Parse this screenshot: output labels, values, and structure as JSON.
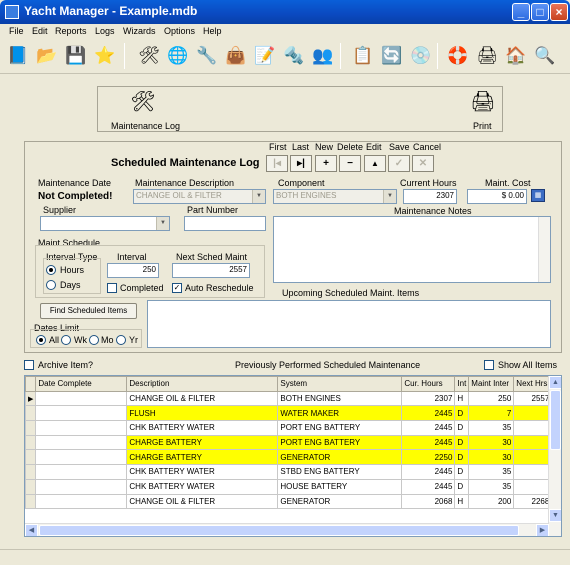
{
  "window": {
    "title": "Yacht Manager - Example.mdb"
  },
  "menu": [
    "File",
    "Edit",
    "Reports",
    "Logs",
    "Wizards",
    "Options",
    "Help"
  ],
  "toolbar": {
    "icons": [
      {
        "name": "book-icon",
        "glyph": "📘"
      },
      {
        "name": "folder-icon",
        "glyph": "📂"
      },
      {
        "name": "save-icon",
        "glyph": "💾"
      },
      {
        "name": "star-icon",
        "glyph": "⭐"
      },
      {
        "name": "edit-icon",
        "glyph": "🛠"
      },
      {
        "name": "globe-icon",
        "glyph": "🌐"
      },
      {
        "name": "tools-icon",
        "glyph": "🔧"
      },
      {
        "name": "bag-icon",
        "glyph": "👜"
      },
      {
        "name": "notes-icon",
        "glyph": "📝"
      },
      {
        "name": "drill-icon",
        "glyph": "🔩"
      },
      {
        "name": "users-icon",
        "glyph": "👥"
      },
      {
        "name": "clipboard-icon",
        "glyph": "📋"
      },
      {
        "name": "refresh-icon",
        "glyph": "🔄"
      },
      {
        "name": "wrench-disk-icon",
        "glyph": "💿"
      },
      {
        "name": "lifebuoy-icon",
        "glyph": "🛟"
      },
      {
        "name": "printer-icon",
        "glyph": "🖨"
      },
      {
        "name": "house-icon",
        "glyph": "🏠"
      },
      {
        "name": "magnifier-icon",
        "glyph": "🔍"
      }
    ]
  },
  "top_panel": {
    "maint_log_label": "Maintenance Log",
    "print_label": "Print"
  },
  "form": {
    "title": "Scheduled Maintenance Log",
    "nav_labels": [
      "First",
      "Last",
      "New",
      "Delete",
      "Edit",
      "Save",
      "Cancel"
    ],
    "maint_date_label": "Maintenance Date",
    "maint_date_value": "Not Completed!",
    "description_label": "Maintenance Description",
    "description_value": "CHANGE OIL & FILTER",
    "component_label": "Component",
    "component_value": "BOTH ENGINES",
    "current_hours_label": "Current Hours",
    "current_hours_value": "2307",
    "maint_cost_label": "Maint. Cost",
    "maint_cost_value": "$ 0.00",
    "supplier_label": "Supplier",
    "supplier_value": "",
    "part_number_label": "Part Number",
    "part_number_value": "",
    "notes_label": "Maintenance Notes",
    "schedule_label": "Maint Schedule",
    "interval_type_label": "Interval Type",
    "hours_label": "Hours",
    "days_label": "Days",
    "interval_label": "Interval",
    "interval_value": "250",
    "next_sched_label": "Next Sched Maint",
    "next_sched_value": "2557",
    "completed_label": "Completed",
    "auto_reschedule_label": "Auto Reschedule",
    "upcoming_label": "Upcoming Scheduled Maint. Items",
    "find_button": "Find Scheduled Items",
    "dates_limit_label": "Dates Limit",
    "dates_limit_options": [
      "All",
      "Wk",
      "Mo",
      "Yr"
    ],
    "archive_label": "Archive Item?",
    "previously_label": "Previously Performed Scheduled Maintenance",
    "show_all_label": "Show All Items"
  },
  "grid": {
    "columns": [
      "Date Complete",
      "Description",
      "System",
      "Cur. Hours",
      "Int",
      "Maint Inter",
      "Next Hrs"
    ],
    "rows": [
      {
        "date": "",
        "description": "CHANGE OIL & FILTER",
        "system": "BOTH ENGINES",
        "hours": "2307",
        "int": "H",
        "interval": "250",
        "next": "2557",
        "highlight": false,
        "current": true
      },
      {
        "date": "",
        "description": "FLUSH",
        "system": "WATER MAKER",
        "hours": "2445",
        "int": "D",
        "interval": "7",
        "next": "",
        "highlight": true,
        "current": false
      },
      {
        "date": "",
        "description": "CHK BATTERY WATER",
        "system": "PORT ENG BATTERY",
        "hours": "2445",
        "int": "D",
        "interval": "35",
        "next": "",
        "highlight": false,
        "current": false
      },
      {
        "date": "",
        "description": "CHARGE BATTERY",
        "system": "PORT ENG BATTERY",
        "hours": "2445",
        "int": "D",
        "interval": "30",
        "next": "",
        "highlight": true,
        "current": false
      },
      {
        "date": "",
        "description": "CHARGE BATTERY",
        "system": "GENERATOR",
        "hours": "2250",
        "int": "D",
        "interval": "30",
        "next": "",
        "highlight": true,
        "current": false
      },
      {
        "date": "",
        "description": "CHK BATTERY WATER",
        "system": "STBD ENG BATTERY",
        "hours": "2445",
        "int": "D",
        "interval": "35",
        "next": "",
        "highlight": false,
        "current": false
      },
      {
        "date": "",
        "description": "CHK BATTERY WATER",
        "system": "HOUSE BATTERY",
        "hours": "2445",
        "int": "D",
        "interval": "35",
        "next": "",
        "highlight": false,
        "current": false
      },
      {
        "date": "",
        "description": "CHANGE OIL & FILTER",
        "system": "GENERATOR",
        "hours": "2068",
        "int": "H",
        "interval": "200",
        "next": "2268",
        "highlight": false,
        "current": false
      }
    ]
  }
}
